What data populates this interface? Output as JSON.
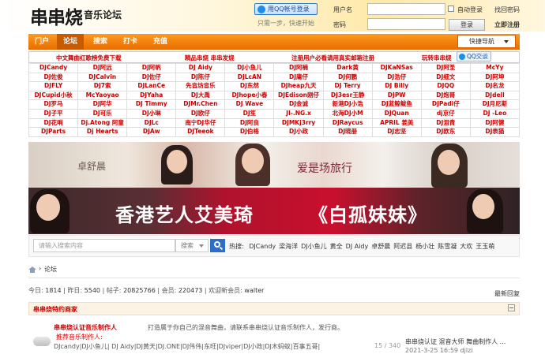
{
  "header": {
    "logo": "串串烧",
    "logo_sub": "音乐论坛",
    "qq_login": "用QQ帐号登录",
    "qq_hint": "只需一步，快速开始",
    "username_label": "用户名",
    "password_label": "密码",
    "auto_login": "自动登录",
    "forgot_password": "找回密码",
    "login_button": "登录",
    "register": "立即注册"
  },
  "nav": {
    "items": [
      "门户",
      "论坛",
      "搜索",
      "打卡",
      "充值"
    ],
    "quick_nav": "快捷导航"
  },
  "notices": [
    "中文舞曲红歌榜免费下载",
    "精品串烧 串串发烧",
    "注册用户必看请用真实邮箱注册",
    "玩转串串烧"
  ],
  "qq_chat": "QQ交谈",
  "link_grid": [
    [
      "DJCandy",
      "DJ阿远",
      "DJ阿帆",
      "DJ Aidy",
      "DJ小鱼儿",
      "DJ阿楠",
      "Dark黄",
      "DJKaNSas",
      "DJ阿圣",
      "McYy"
    ],
    [
      "DJ佐俊",
      "DJCalvin",
      "DJ佐仔",
      "DJ陈仔",
      "DJLcAN",
      "DJ庸仔",
      "DJ何鹏",
      "DJ浩仔",
      "DJ细文",
      "DJ阿坤"
    ],
    [
      "DJFLY",
      "DJ7索",
      "DJLanCe",
      "先音坊音乐",
      "DJ东然",
      "DJheap九天",
      "DJ Terry",
      "DJ Billy",
      "DJQQ",
      "DJ名龙"
    ],
    [
      "DJCupid小秋",
      "McYaoyao",
      "DJYaha",
      "DJ大禹",
      "DJhope小春",
      "DJEdison刚仔",
      "DJ3esr王静",
      "DJPW",
      "DJ炮哥",
      "DJdell"
    ],
    [
      "DJ罗马",
      "DJ阿华",
      "DJ Timmy",
      "DJMr.Chen",
      "DJ Wave",
      "DJ金诚",
      "新港DJ小浩",
      "DJ蓝鲸鲅鱼",
      "DJPadi仔",
      "DJ月尼斯"
    ],
    [
      "DJ子平",
      "DJ可乐",
      "DJ小琳",
      "DJ欧仔",
      "DJ笙",
      "JI-.NG.x",
      "北海DJ小M",
      "DJQuan",
      "dj京仔",
      "DJ -Leo"
    ],
    [
      "DJ花哨",
      "Dj.Atong 阿童",
      "DJLc",
      "南宁DJ华仔",
      "DJ阿良",
      "DJMKj3rry",
      "DJRaycus",
      "APRIL 姜美",
      "DJ泪青",
      "DJ阿健"
    ],
    [
      "DJParts",
      "Dj Hearts",
      "DJAw",
      "DJTeeok",
      "DJ伯格",
      "DJ小政",
      "DJ晓册",
      "DJ志坚",
      "DJ欧东",
      "DJ表猫"
    ]
  ],
  "banner": {
    "line1_left": "卓舒晨",
    "line1_right": "爱是场旅行",
    "title_a": "香港艺人艾美琦",
    "title_b": "《白孤妹妹》"
  },
  "search": {
    "placeholder": "请输入搜索内容",
    "type": "搜索",
    "hot_label": "热搜:",
    "hot_keywords": [
      "DJCandy",
      "梁海洋",
      "DJ小鱼儿",
      "黄全",
      "DJ Aidy",
      "卓舒晨",
      "阿迟县",
      "杨小壮",
      "陈雪凝",
      "大欢",
      "王玉萌"
    ]
  },
  "breadcrumb": "论坛",
  "stats": {
    "today_label": "今日:",
    "today": "1814",
    "yesterday_label": "昨日:",
    "yesterday": "5540",
    "posts_label": "帖子:",
    "posts": "20825766",
    "members_label": "会员:",
    "members": "220473",
    "welcome_label": "欢迎新会员:",
    "newest_member": "walter",
    "newest_reply": "最新回复"
  },
  "category": {
    "title": "串串烧特约商家"
  },
  "forum": {
    "name": "串串烧认证音乐制作人",
    "desc": "打造属于你自己的混音舞曲，请联系串串烧认证音乐制作人，发行商。",
    "mods": "推荐音乐制作人:",
    "users": "DJcandy|DJ小鱼儿| DJ Aidy|DJ黄天|DJ.ONE|DJ伟伟|东旺|DJviper|DJ小政|DJ木蚂蚁|百事五哥|",
    "count": "15 / 340",
    "last_title": "串串烧认证 混音大师 舞曲制作人 ...",
    "last_time": "2021-3-25 16:59 djlzi"
  }
}
